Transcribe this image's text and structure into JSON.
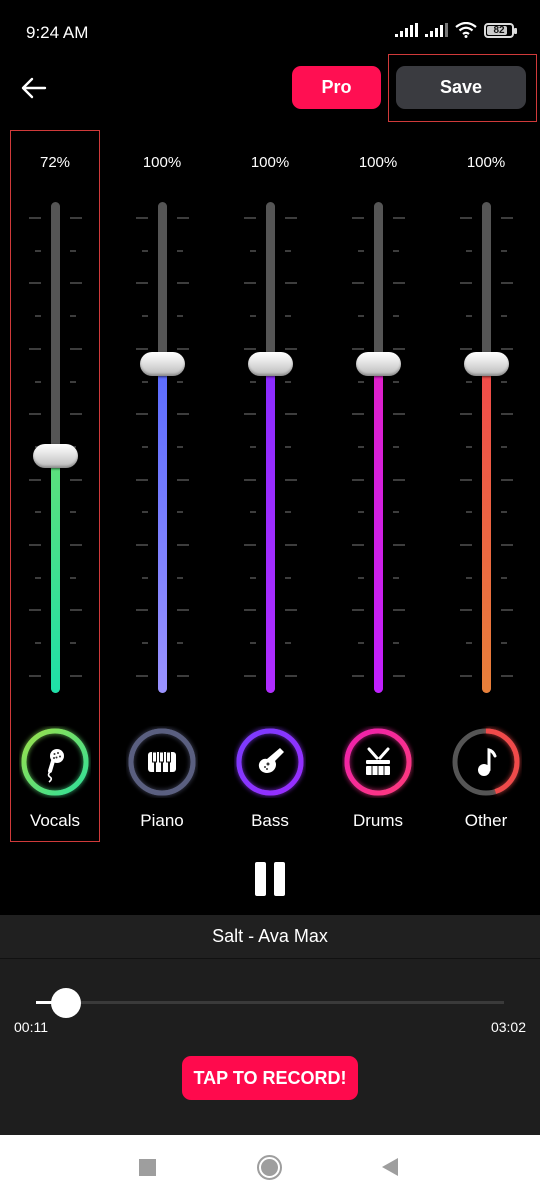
{
  "status_bar": {
    "time": "9:24 AM",
    "battery": "82",
    "battery_level": 0.82,
    "icons": [
      "signal-icon",
      "signal-icon",
      "wifi-icon",
      "battery-icon"
    ]
  },
  "top_bar": {
    "back_icon": "arrow-left-icon",
    "pro_label": "Pro",
    "save_label": "Save",
    "pro_color": "#ff0f52",
    "save_color": "#3a3b40"
  },
  "channels": [
    {
      "id": "vocals",
      "label": "Vocals",
      "percent_label": "72%",
      "level": 0.72,
      "icon": "microphone-icon",
      "color_top": "#5ee07a",
      "color_bottom": "#1ee0a8",
      "ring": [
        "#2ee09a",
        "#9be04a"
      ],
      "ring_fill": 1.0,
      "selected": true
    },
    {
      "id": "piano",
      "label": "Piano",
      "percent_label": "100%",
      "level": 1.0,
      "icon": "piano-keys-icon",
      "color_top": "#5b6cff",
      "color_bottom": "#9a92ff",
      "ring": [
        "#5a5f80",
        "#5a5f80"
      ],
      "ring_fill": 1.0,
      "selected": false
    },
    {
      "id": "bass",
      "label": "Bass",
      "percent_label": "100%",
      "level": 1.0,
      "icon": "guitar-icon",
      "color_top": "#8a2cff",
      "color_bottom": "#b02cff",
      "ring": [
        "#9a2cff",
        "#7a3cff"
      ],
      "ring_fill": 1.0,
      "selected": false
    },
    {
      "id": "drums",
      "label": "Drums",
      "percent_label": "100%",
      "level": 1.0,
      "icon": "drum-icon",
      "color_top": "#e020c8",
      "color_bottom": "#c020ff",
      "ring": [
        "#ff3a7a",
        "#ee1fb0"
      ],
      "ring_fill": 1.0,
      "selected": false
    },
    {
      "id": "other",
      "label": "Other",
      "percent_label": "100%",
      "level": 1.0,
      "icon": "music-note-icon",
      "color_top": "#f04a4a",
      "color_bottom": "#e8803a",
      "ring": [
        "#f04a4a",
        "#f04a4a"
      ],
      "ring_fill": 0.45,
      "selected": false
    }
  ],
  "slider_max_ratio_note": "100% = thumb at upper third of track",
  "transport": {
    "pause_icon": "pause-icon"
  },
  "player": {
    "song_title": "Salt - Ava Max",
    "current_time": "00:11",
    "total_time": "03:02",
    "progress": 0.064,
    "record_label": "TAP TO RECORD!",
    "record_color": "#ff0a4d"
  },
  "nav_bar": {
    "items": [
      "recent-apps-icon",
      "home-icon",
      "back-icon"
    ]
  }
}
